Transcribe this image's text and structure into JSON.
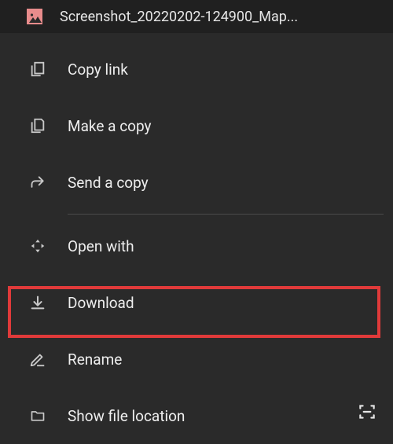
{
  "header": {
    "filename": "Screenshot_20220202-124900_Map..."
  },
  "menu": {
    "copy_link": "Copy link",
    "make_copy": "Make a copy",
    "send_copy": "Send a copy",
    "open_with": "Open with",
    "download": "Download",
    "rename": "Rename",
    "show_location": "Show file location"
  }
}
